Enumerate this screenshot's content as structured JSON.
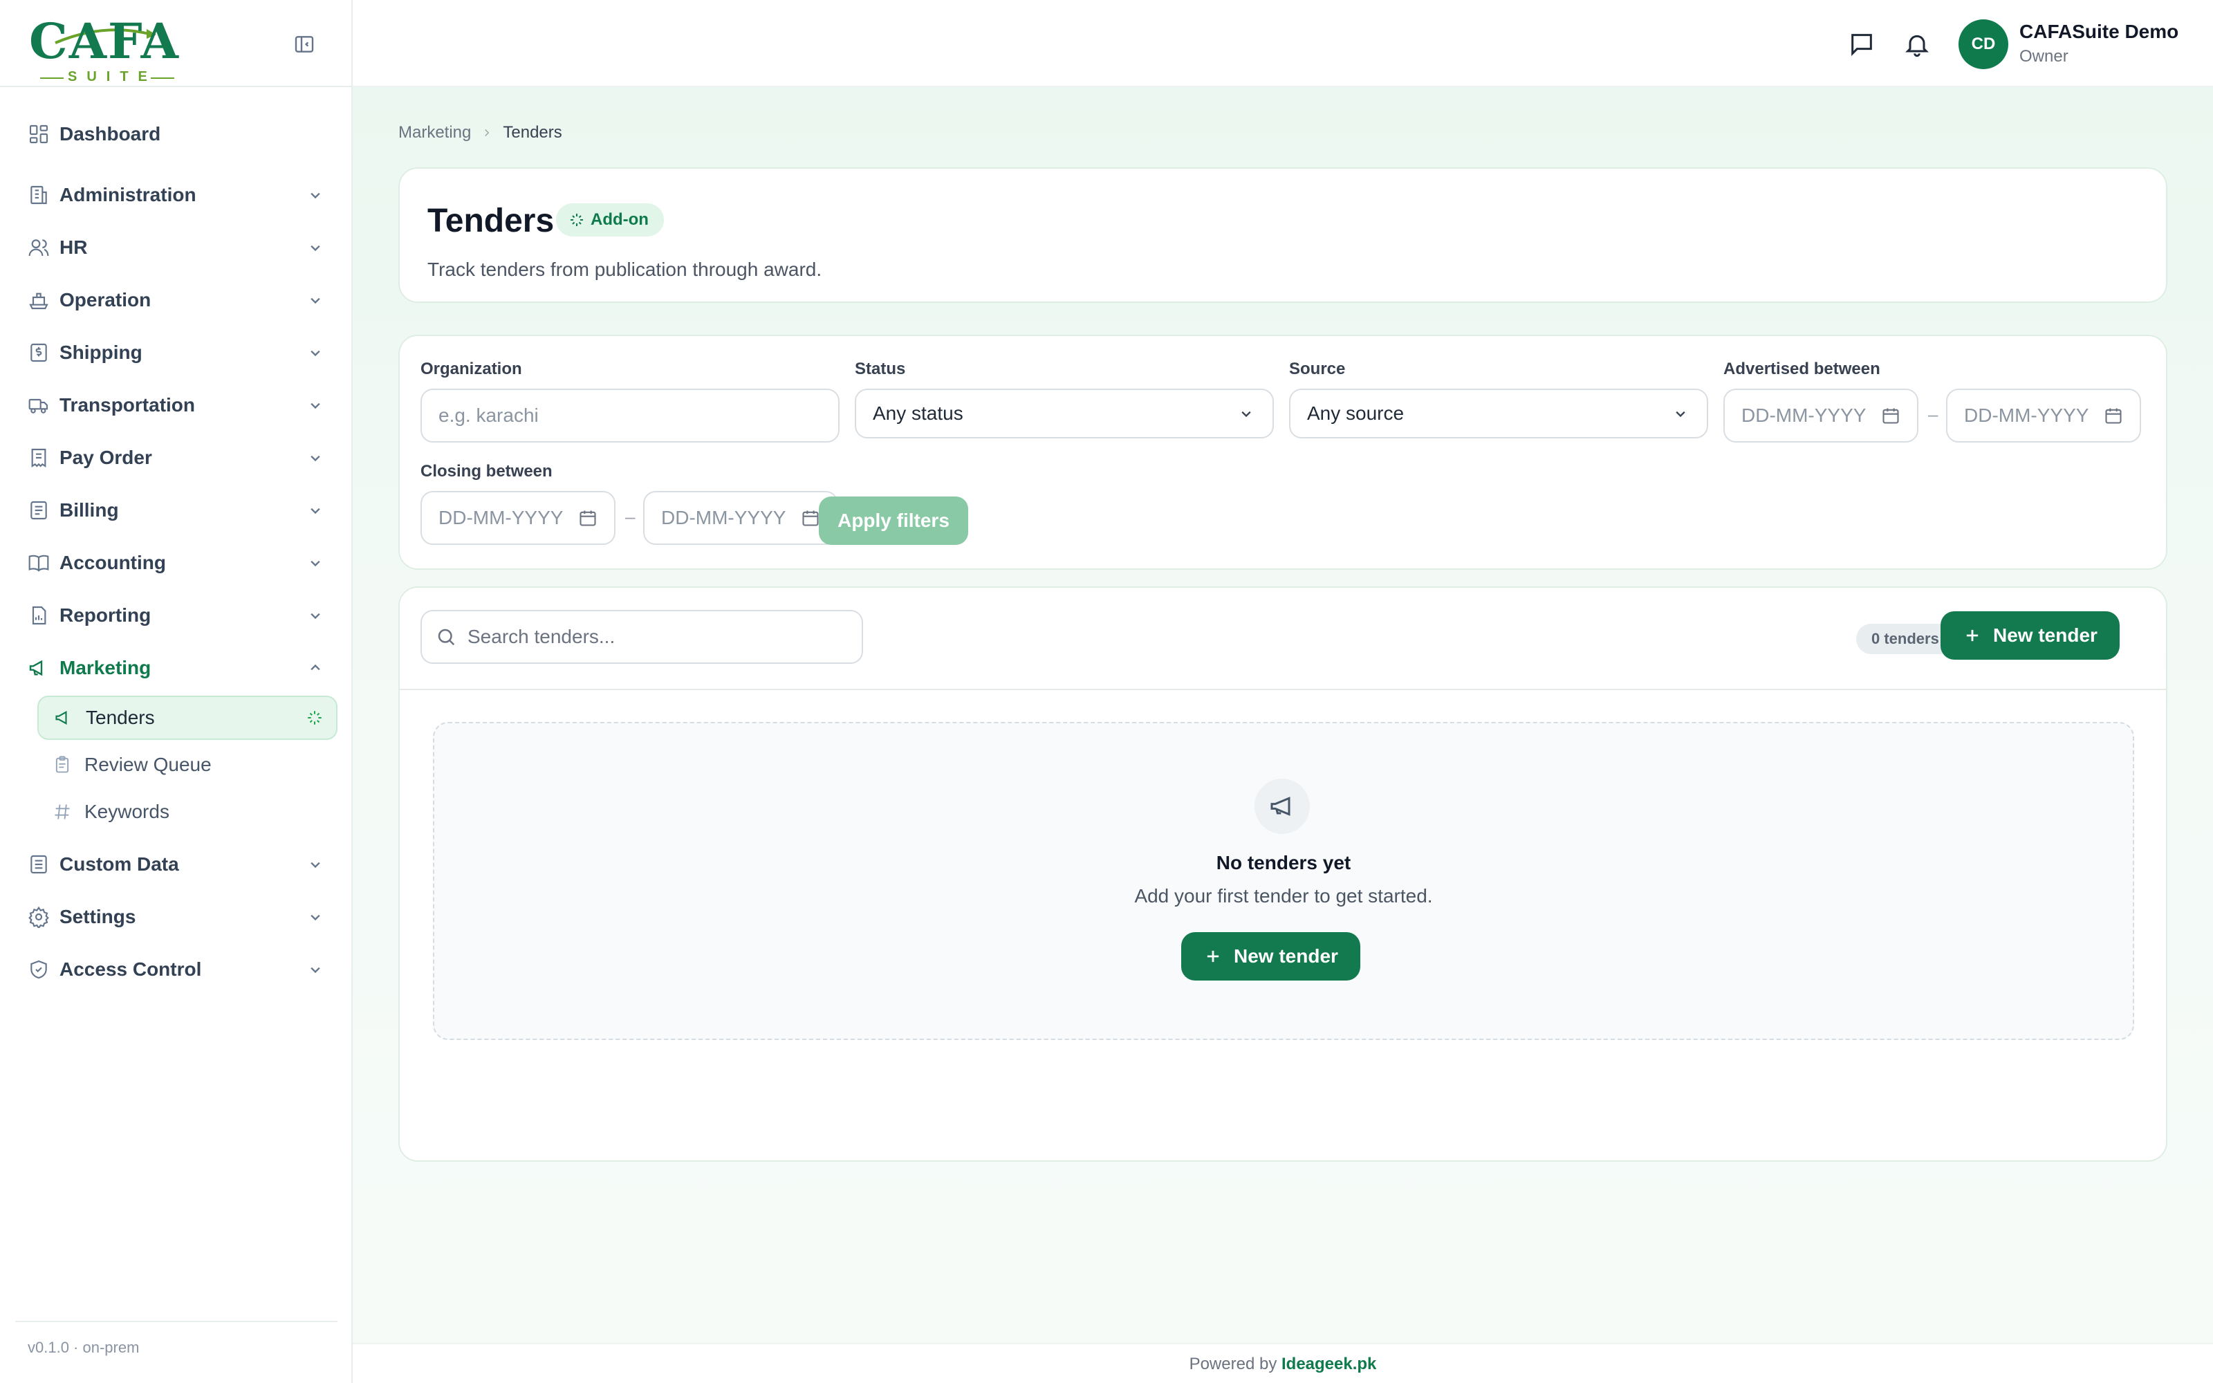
{
  "brand": {
    "logo_text": "CAFA",
    "logo_sub": "SUITE"
  },
  "sidebar": {
    "items": [
      {
        "label": "Dashboard",
        "icon": "dashboard-icon"
      },
      {
        "label": "Administration",
        "icon": "building-icon"
      },
      {
        "label": "HR",
        "icon": "users-icon"
      },
      {
        "label": "Operation",
        "icon": "ship-icon"
      },
      {
        "label": "Shipping",
        "icon": "dollar-doc-icon"
      },
      {
        "label": "Transportation",
        "icon": "truck-icon"
      },
      {
        "label": "Pay Order",
        "icon": "receipt-icon"
      },
      {
        "label": "Billing",
        "icon": "invoice-icon"
      },
      {
        "label": "Accounting",
        "icon": "book-icon"
      },
      {
        "label": "Reporting",
        "icon": "report-icon"
      },
      {
        "label": "Marketing",
        "icon": "megaphone-icon"
      },
      {
        "label": "Custom Data",
        "icon": "database-doc-icon"
      },
      {
        "label": "Settings",
        "icon": "gear-icon"
      },
      {
        "label": "Access Control",
        "icon": "shield-icon"
      }
    ],
    "sub_items": [
      {
        "label": "Tenders",
        "icon": "megaphone-icon"
      },
      {
        "label": "Review Queue",
        "icon": "clipboard-icon"
      },
      {
        "label": "Keywords",
        "icon": "hash-icon"
      }
    ],
    "footer": "v0.1.0 · on-prem"
  },
  "topbar": {
    "avatar_initials": "CD",
    "user_name": "CAFASuite Demo",
    "user_role": "Owner"
  },
  "breadcrumb": {
    "parent": "Marketing",
    "current": "Tenders"
  },
  "header": {
    "title": "Tenders",
    "badge": "Add-on",
    "subtitle": "Track tenders from publication through award."
  },
  "filters": {
    "organization": {
      "label": "Organization",
      "placeholder": "e.g. karachi"
    },
    "status": {
      "label": "Status",
      "value": "Any status"
    },
    "source": {
      "label": "Source",
      "value": "Any source"
    },
    "advertised": {
      "label": "Advertised between",
      "from_placeholder": "DD-MM-YYYY",
      "to_placeholder": "DD-MM-YYYY",
      "separator": "–"
    },
    "closing": {
      "label": "Closing between",
      "from_placeholder": "DD-MM-YYYY",
      "to_placeholder": "DD-MM-YYYY",
      "separator": "–"
    },
    "apply_label": "Apply filters"
  },
  "list": {
    "search_placeholder": "Search tenders...",
    "count_label": "0 tenders",
    "new_button": "New tender",
    "empty_title": "No tenders yet",
    "empty_subtitle": "Add your first tender to get started.",
    "empty_button": "New tender"
  },
  "footer": {
    "prefix": "Powered by",
    "link": "Ideageek.pk"
  },
  "colors": {
    "accent": "#137a4f",
    "accent_light": "#e1f5e9",
    "lime": "#6aa32a"
  }
}
